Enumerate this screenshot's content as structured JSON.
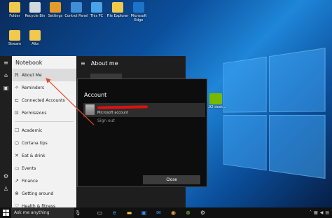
{
  "desktop": {
    "icons": [
      {
        "label": "Folder",
        "icon": "folder-icon",
        "color": "#f2c94c"
      },
      {
        "label": "Recycle Bin",
        "icon": "recycle-bin-icon",
        "color": "#cfd8dc"
      },
      {
        "label": "Settings",
        "icon": "settings-icon",
        "color": "#e39b2a"
      },
      {
        "label": "Control Panel",
        "icon": "control-panel-icon",
        "color": "#3f8fd6"
      },
      {
        "label": "This PC",
        "icon": "this-pc-icon",
        "color": "#4aa3e6"
      },
      {
        "label": "File Explorer",
        "icon": "file-explorer-icon",
        "color": "#f2c94c"
      },
      {
        "label": "Microsoft Edge",
        "icon": "edge-icon",
        "color": "#1e73c9"
      },
      {
        "label": "Stream",
        "icon": "folder-icon",
        "color": "#f2c94c"
      },
      {
        "label": "Alta",
        "icon": "folder-icon",
        "color": "#f2c94c"
      }
    ],
    "nvidia_label": "1.92-desk..."
  },
  "cortana_rail": {
    "icons": [
      "hamburger-icon",
      "home-icon",
      "notebook-icon",
      "settings-icon",
      "feedback-icon"
    ]
  },
  "notebook": {
    "title": "Notebook",
    "items": [
      {
        "label": "About Me",
        "icon": "people-icon",
        "selected": true
      },
      {
        "label": "Reminders",
        "icon": "bulb-icon"
      },
      {
        "label": "Connected Accounts",
        "icon": "link-icon"
      },
      {
        "label": "Permissions",
        "icon": "lock-icon"
      },
      {
        "label": "Academic",
        "icon": "academic-icon"
      },
      {
        "label": "Cortana tips",
        "icon": "tips-icon"
      },
      {
        "label": "Eat & drink",
        "icon": "food-icon"
      },
      {
        "label": "Events",
        "icon": "calendar-icon"
      },
      {
        "label": "Finance",
        "icon": "finance-icon"
      },
      {
        "label": "Getting around",
        "icon": "car-icon"
      },
      {
        "label": "Health & fitness",
        "icon": "health-icon"
      }
    ]
  },
  "about_me": {
    "title": "About me"
  },
  "account_dialog": {
    "title": "Account",
    "account_type": "Microsoft account",
    "sign_out": "Sign out",
    "close_label": "Close"
  },
  "taskbar": {
    "search_placeholder": "Ask me anything",
    "apps": [
      "task-view-icon",
      "edge-icon",
      "file-explorer-icon",
      "store-icon",
      "mail-icon",
      "chrome-icon",
      "xbox-icon",
      "settings-icon"
    ],
    "tray": [
      "up-arrow-icon",
      "network-icon",
      "volume-icon",
      "action-center-icon"
    ]
  },
  "colors": {
    "annotation_arrow": "#e34a2a",
    "redaction": "#e01010"
  }
}
